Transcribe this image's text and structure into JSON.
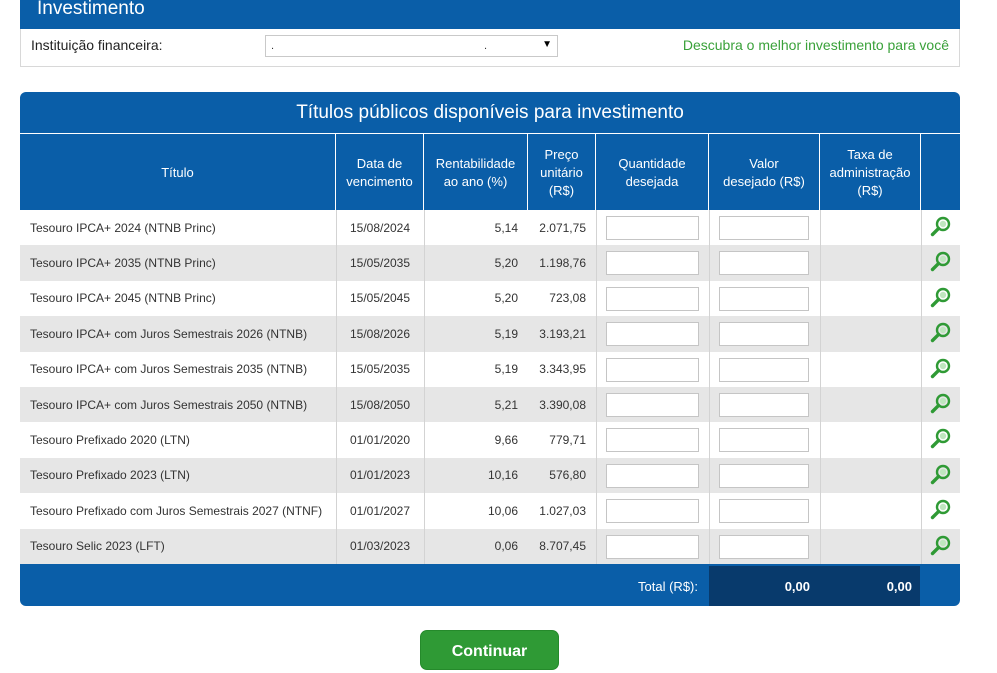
{
  "top": {
    "title": "Investimento",
    "institution_label": "Instituição financeira:",
    "select_value_left": ".",
    "select_value_right": ".",
    "discover_link": "Descubra o melhor investimento para você"
  },
  "table": {
    "title": "Títulos públicos disponíveis para investimento",
    "headers": {
      "titulo": "Título",
      "vencimento": "Data de\nvencimento",
      "rentabilidade": "Rentabilidade\nao ano (%)",
      "preco": "Preço\nunitário\n(R$)",
      "quantidade": "Quantidade\ndesejada",
      "valor": "Valor\ndesejado (R$)",
      "taxa": "Taxa de\nadministração\n(R$)"
    },
    "rows": [
      {
        "titulo": "Tesouro IPCA+ 2024 (NTNB Princ)",
        "vencimento": "15/08/2024",
        "rentabilidade": "5,14",
        "preco": "2.071,75"
      },
      {
        "titulo": "Tesouro IPCA+ 2035 (NTNB Princ)",
        "vencimento": "15/05/2035",
        "rentabilidade": "5,20",
        "preco": "1.198,76"
      },
      {
        "titulo": "Tesouro IPCA+ 2045 (NTNB Princ)",
        "vencimento": "15/05/2045",
        "rentabilidade": "5,20",
        "preco": "723,08"
      },
      {
        "titulo": "Tesouro IPCA+ com Juros Semestrais 2026 (NTNB)",
        "vencimento": "15/08/2026",
        "rentabilidade": "5,19",
        "preco": "3.193,21"
      },
      {
        "titulo": "Tesouro IPCA+ com Juros Semestrais 2035 (NTNB)",
        "vencimento": "15/05/2035",
        "rentabilidade": "5,19",
        "preco": "3.343,95"
      },
      {
        "titulo": "Tesouro IPCA+ com Juros Semestrais 2050 (NTNB)",
        "vencimento": "15/08/2050",
        "rentabilidade": "5,21",
        "preco": "3.390,08"
      },
      {
        "titulo": "Tesouro Prefixado 2020 (LTN)",
        "vencimento": "01/01/2020",
        "rentabilidade": "9,66",
        "preco": "779,71"
      },
      {
        "titulo": "Tesouro Prefixado 2023 (LTN)",
        "vencimento": "01/01/2023",
        "rentabilidade": "10,16",
        "preco": "576,80"
      },
      {
        "titulo": "Tesouro Prefixado com Juros Semestrais 2027 (NTNF)",
        "vencimento": "01/01/2027",
        "rentabilidade": "10,06",
        "preco": "1.027,03"
      },
      {
        "titulo": "Tesouro Selic 2023 (LFT)",
        "vencimento": "01/03/2023",
        "rentabilidade": "0,06",
        "preco": "8.707,45"
      }
    ],
    "total_label": "Total (R$):",
    "total_valor": "0,00",
    "total_taxa": "0,00"
  },
  "continue_button": "Continuar",
  "colors": {
    "brand_blue": "#0a5ea8",
    "dark_blue": "#083a6c",
    "accent_green": "#2f9a35",
    "link_green": "#3aa13a"
  },
  "icons": {
    "row_detail": "zoom-icon",
    "select_arrow": "dropdown-arrow-icon"
  }
}
